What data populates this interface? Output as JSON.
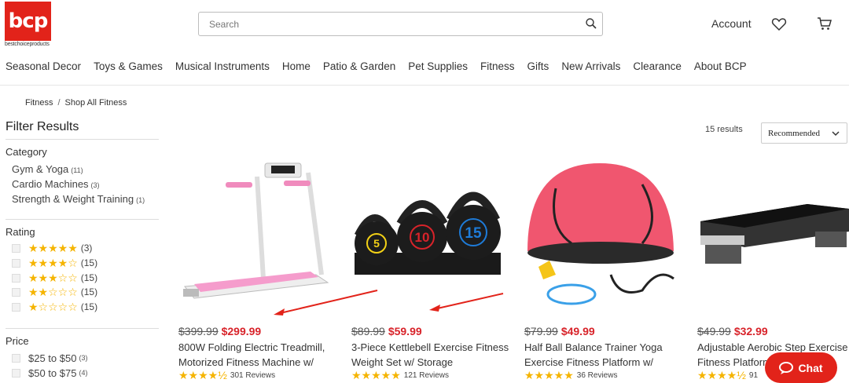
{
  "brand": {
    "logo_text": "bcp",
    "logo_sub": "bestchoiceproducts"
  },
  "search": {
    "placeholder": "Search"
  },
  "header": {
    "account_label": "Account"
  },
  "nav": [
    "Seasonal Decor",
    "Toys & Games",
    "Musical Instruments",
    "Home",
    "Patio & Garden",
    "Pet Supplies",
    "Fitness",
    "Gifts",
    "New Arrivals",
    "Clearance",
    "About BCP"
  ],
  "breadcrumb": {
    "parent": "Fitness",
    "current": "Shop All Fitness",
    "separator": "/"
  },
  "filters": {
    "title": "Filter Results",
    "category": {
      "title": "Category",
      "items": [
        {
          "label": "Gym & Yoga",
          "count": "(11)"
        },
        {
          "label": "Cardio Machines",
          "count": "(3)"
        },
        {
          "label": "Strength & Weight Training",
          "count": "(1)"
        }
      ]
    },
    "rating": {
      "title": "Rating",
      "items": [
        {
          "stars": "★★★★★",
          "count": "(3)"
        },
        {
          "stars": "★★★★☆",
          "count": "(15)"
        },
        {
          "stars": "★★★☆☆",
          "count": "(15)"
        },
        {
          "stars": "★★☆☆☆",
          "count": "(15)"
        },
        {
          "stars": "★☆☆☆☆",
          "count": "(15)"
        }
      ]
    },
    "price": {
      "title": "Price",
      "items": [
        {
          "label": "$25 to $50",
          "count": "(3)"
        },
        {
          "label": "$50 to $75",
          "count": "(4)"
        }
      ]
    }
  },
  "results": {
    "count_label": "15 results",
    "sort_selected": "Recommended"
  },
  "products": [
    {
      "old_price": "$399.99",
      "new_price": "$299.99",
      "name": "800W Folding Electric Treadmill, Motorized Fitness Machine w/",
      "stars": "★★★★½",
      "reviews": "301 Reviews"
    },
    {
      "old_price": "$89.99",
      "new_price": "$59.99",
      "name": "3-Piece Kettlebell Exercise Fitness Weight Set w/ Storage",
      "stars": "★★★★★",
      "reviews": "121 Reviews"
    },
    {
      "old_price": "$79.99",
      "new_price": "$49.99",
      "name": "Half Ball Balance Trainer Yoga Exercise Fitness Platform w/",
      "stars": "★★★★★",
      "reviews": "36 Reviews"
    },
    {
      "old_price": "$49.99",
      "new_price": "$32.99",
      "name": "Adjustable Aerobic Step Exercise Fitness Platform",
      "stars": "★★★★½",
      "reviews": "91"
    }
  ],
  "kettlebell_labels": [
    "5",
    "10",
    "15"
  ],
  "chat": {
    "label": "Chat"
  },
  "colors": {
    "brand_red": "#e2231a",
    "sale_red": "#d8232a",
    "star": "#f5b400"
  },
  "icons": {
    "search": "search-icon",
    "heart": "heart-icon",
    "cart": "cart-icon",
    "chevron": "chevron-down-icon",
    "chat": "chat-bubble-icon"
  }
}
